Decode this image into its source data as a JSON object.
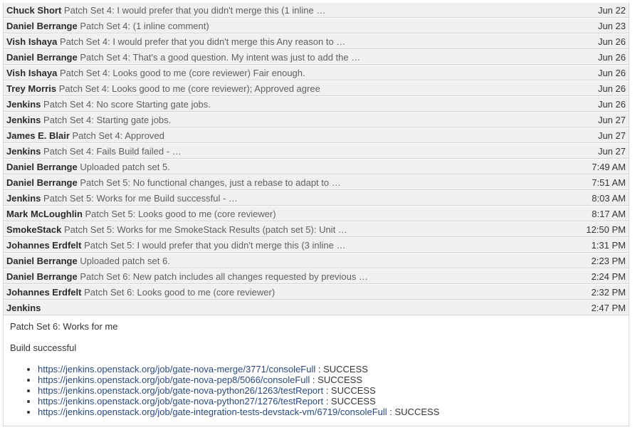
{
  "messages": [
    {
      "author": "Chuck Short",
      "summary": "Patch Set 4: I would prefer that you didn't merge this (1 inline …",
      "date": "Jun 22"
    },
    {
      "author": "Daniel Berrange",
      "summary": "Patch Set 4: (1 inline comment)",
      "date": "Jun 23"
    },
    {
      "author": "Vish Ishaya",
      "summary": "Patch Set 4: I would prefer that you didn't merge this Any reason to …",
      "date": "Jun 26"
    },
    {
      "author": "Daniel Berrange",
      "summary": "Patch Set 4: That's a good question. My intent was just to add the …",
      "date": "Jun 26"
    },
    {
      "author": "Vish Ishaya",
      "summary": "Patch Set 4: Looks good to me (core reviewer) Fair enough.",
      "date": "Jun 26"
    },
    {
      "author": "Trey Morris",
      "summary": "Patch Set 4: Looks good to me (core reviewer); Approved agree",
      "date": "Jun 26"
    },
    {
      "author": "Jenkins",
      "summary": "Patch Set 4: No score Starting gate jobs.",
      "date": "Jun 26"
    },
    {
      "author": "Jenkins",
      "summary": "Patch Set 4: Starting gate jobs.",
      "date": "Jun 27"
    },
    {
      "author": "James E. Blair",
      "summary": "Patch Set 4: Approved",
      "date": "Jun 27"
    },
    {
      "author": "Jenkins",
      "summary": "Patch Set 4: Fails Build failed - …",
      "date": "Jun 27"
    },
    {
      "author": "Daniel Berrange",
      "summary": "Uploaded patch set 5.",
      "date": "7:49 AM"
    },
    {
      "author": "Daniel Berrange",
      "summary": "Patch Set 5: No functional changes, just a rebase to adapt to …",
      "date": "7:51 AM"
    },
    {
      "author": "Jenkins",
      "summary": "Patch Set 5: Works for me Build successful - …",
      "date": "8:03 AM"
    },
    {
      "author": "Mark McLoughlin",
      "summary": "Patch Set 5: Looks good to me (core reviewer)",
      "date": "8:17 AM"
    },
    {
      "author": "SmokeStack",
      "summary": "Patch Set 5: Works for me SmokeStack Results (patch set 5): Unit …",
      "date": "12:50 PM"
    },
    {
      "author": "Johannes Erdfelt",
      "summary": "Patch Set 5: I would prefer that you didn't merge this (3 inline …",
      "date": "1:31 PM"
    },
    {
      "author": "Daniel Berrange",
      "summary": "Uploaded patch set 6.",
      "date": "2:23 PM"
    },
    {
      "author": "Daniel Berrange",
      "summary": "Patch Set 6: New patch includes all changes requested by previous …",
      "date": "2:24 PM"
    },
    {
      "author": "Johannes Erdfelt",
      "summary": "Patch Set 6: Looks good to me (core reviewer)",
      "date": "2:32 PM"
    }
  ],
  "expanded": {
    "author": "Jenkins",
    "date": "2:47 PM",
    "line1": "Patch Set 6: Works for me",
    "line2": "Build successful",
    "results": [
      {
        "url": "https://jenkins.openstack.org/job/gate-nova-merge/3771/consoleFull",
        "status": " : SUCCESS"
      },
      {
        "url": "https://jenkins.openstack.org/job/gate-nova-pep8/5066/consoleFull",
        "status": " : SUCCESS"
      },
      {
        "url": "https://jenkins.openstack.org/job/gate-nova-python26/1263/testReport",
        "status": " : SUCCESS"
      },
      {
        "url": "https://jenkins.openstack.org/job/gate-nova-python27/1276/testReport",
        "status": " : SUCCESS"
      },
      {
        "url": "https://jenkins.openstack.org/job/gate-integration-tests-devstack-vm/6719/consoleFull",
        "status": " : SUCCESS"
      }
    ]
  }
}
